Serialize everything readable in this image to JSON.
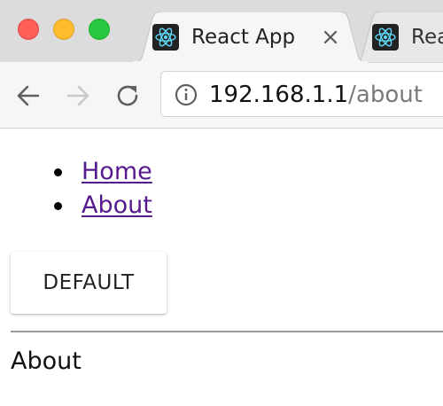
{
  "browser": {
    "tabs": [
      {
        "title": "React App",
        "active": true,
        "favicon": "react-logo-icon"
      },
      {
        "title": "Rea",
        "active": false,
        "favicon": "react-logo-icon"
      }
    ],
    "address": {
      "host": "192.168.1.1",
      "path": "/about"
    },
    "colors": {
      "traffic_close": "#fe5f57",
      "traffic_minimize": "#febc2e",
      "traffic_maximize": "#28c840",
      "react_cyan": "#61dafb",
      "link_visited": "#551a8b"
    }
  },
  "page": {
    "nav": [
      {
        "label": "Home"
      },
      {
        "label": "About"
      }
    ],
    "button_label": "DEFAULT",
    "heading": "About"
  }
}
